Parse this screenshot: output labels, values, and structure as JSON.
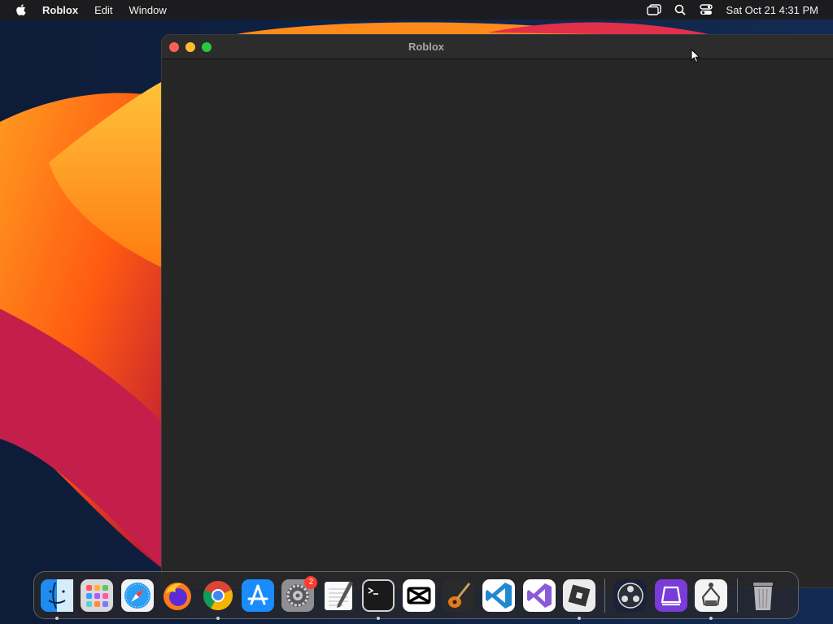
{
  "menubar": {
    "app_name": "Roblox",
    "items": [
      "Edit",
      "Window"
    ],
    "clock": "Sat Oct 21  4:31 PM"
  },
  "window": {
    "title": "Roblox"
  },
  "dock": {
    "badge_settings": "2",
    "apps": [
      "finder-icon",
      "launchpad-icon",
      "safari-icon",
      "firefox-icon",
      "chrome-icon",
      "app-store-icon",
      "system-settings-icon",
      "textedit-icon",
      "terminal-icon",
      "capcut-icon",
      "garageband-icon",
      "vscode-icon",
      "visual-studio-icon",
      "roblox-icon",
      "obs-icon",
      "podcast-app-icon",
      "claw-app-icon",
      "trash-icon"
    ]
  },
  "colors": {
    "menubar_bg": "#1c1c1e",
    "window_bg": "#262626",
    "titlebar_bg": "#2c2c2c"
  }
}
